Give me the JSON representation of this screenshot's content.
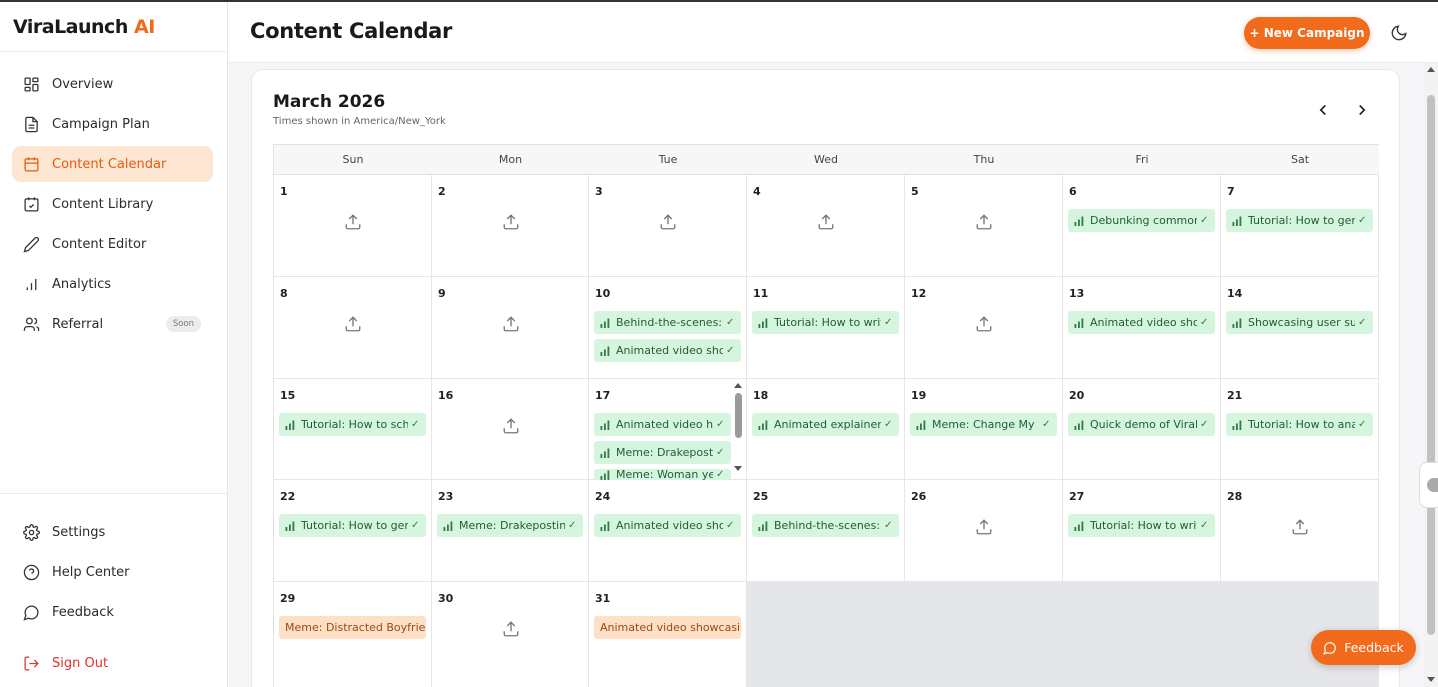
{
  "brand": {
    "name": "ViraLaunch",
    "suffix": "AI"
  },
  "sidebar": {
    "items": [
      {
        "label": "Overview",
        "icon": "grid-icon"
      },
      {
        "label": "Campaign Plan",
        "icon": "file-text-icon"
      },
      {
        "label": "Content Calendar",
        "icon": "calendar-icon",
        "active": true
      },
      {
        "label": "Content Library",
        "icon": "calendar-check-icon"
      },
      {
        "label": "Content Editor",
        "icon": "pencil-icon"
      },
      {
        "label": "Analytics",
        "icon": "bar-chart-icon"
      },
      {
        "label": "Referral",
        "icon": "users-icon",
        "badge": "Soon"
      }
    ],
    "bottom": [
      {
        "label": "Settings",
        "icon": "gear-icon"
      },
      {
        "label": "Help Center",
        "icon": "help-circle-icon"
      },
      {
        "label": "Feedback",
        "icon": "message-icon"
      },
      {
        "label": "Sign Out",
        "icon": "log-out-icon"
      }
    ]
  },
  "header": {
    "title": "Content Calendar",
    "new_campaign": "+ New Campaign"
  },
  "calendar": {
    "month": "March 2026",
    "timezone_note": "Times shown in America/New_York",
    "weekdays": [
      "Sun",
      "Mon",
      "Tue",
      "Wed",
      "Thu",
      "Fri",
      "Sat"
    ],
    "days": {
      "6": [
        {
          "text": "Debunking common s",
          "status": "green"
        }
      ],
      "7": [
        {
          "text": "Tutorial: How to gene",
          "status": "green"
        }
      ],
      "10": [
        {
          "text": "Behind-the-scenes: Sh",
          "status": "green"
        },
        {
          "text": "Animated video show",
          "status": "green"
        }
      ],
      "11": [
        {
          "text": "Tutorial: How to write",
          "status": "green"
        }
      ],
      "13": [
        {
          "text": "Animated video show",
          "status": "green"
        }
      ],
      "14": [
        {
          "text": "Showcasing user succ",
          "status": "green"
        }
      ],
      "15": [
        {
          "text": "Tutorial: How to sche",
          "status": "green"
        }
      ],
      "17": [
        {
          "text": "Animated video hig",
          "status": "green"
        },
        {
          "text": "Meme: Drakeposti",
          "status": "green"
        },
        {
          "text": "Meme: Woman yel",
          "status": "green"
        }
      ],
      "18": [
        {
          "text": "Animated explainer vi",
          "status": "green"
        }
      ],
      "19": [
        {
          "text": "Meme: Change My Mi",
          "status": "green"
        }
      ],
      "20": [
        {
          "text": "Quick demo of ViraLa",
          "status": "green"
        }
      ],
      "21": [
        {
          "text": "Tutorial: How to analy",
          "status": "green"
        }
      ],
      "22": [
        {
          "text": "Tutorial: How to gene",
          "status": "green"
        }
      ],
      "23": [
        {
          "text": "Meme: Drakeposting",
          "status": "green"
        }
      ],
      "24": [
        {
          "text": "Animated video show",
          "status": "green"
        }
      ],
      "25": [
        {
          "text": "Behind-the-scenes: Sh",
          "status": "green"
        }
      ],
      "27": [
        {
          "text": "Tutorial: How to write",
          "status": "green"
        }
      ],
      "29": [
        {
          "text": "Meme: Distracted Boyfriend",
          "status": "orange"
        }
      ],
      "31": [
        {
          "text": "Animated video showcasing",
          "status": "orange"
        }
      ]
    }
  },
  "feedback_button": "Feedback",
  "colors": {
    "accent": "#f26a1b",
    "published": "#d6f5df",
    "draft": "#fde0c5"
  }
}
